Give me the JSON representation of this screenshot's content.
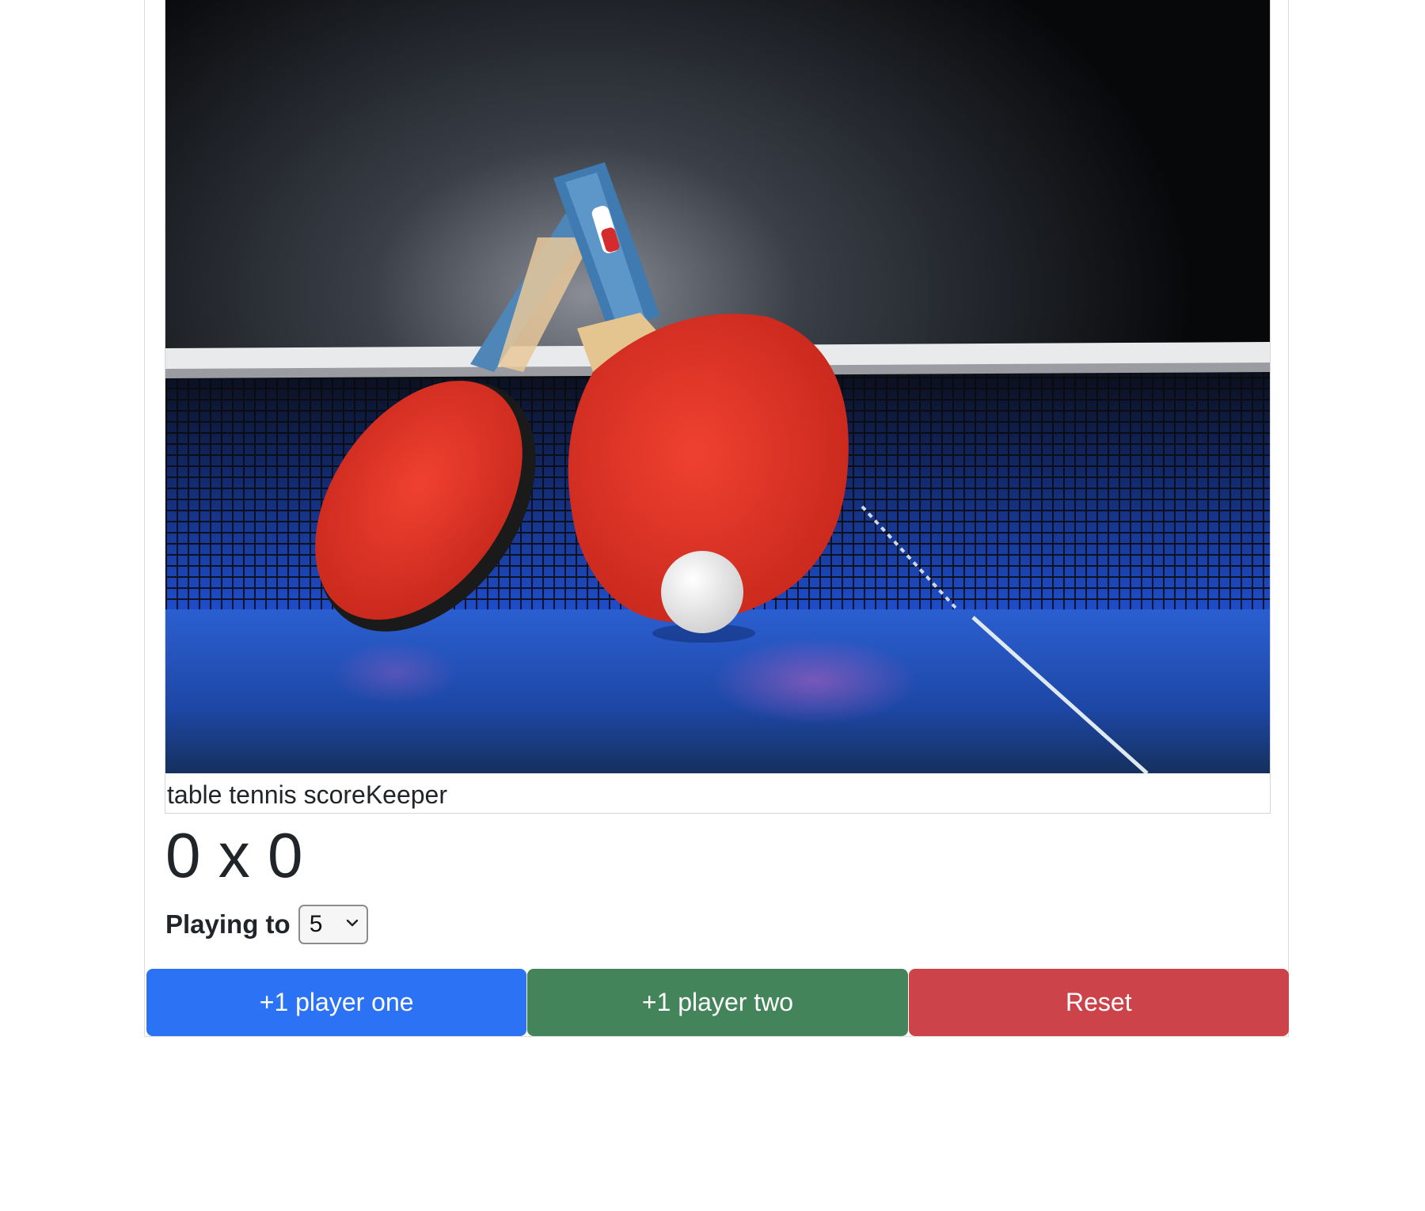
{
  "card": {
    "caption": "table tennis scoreKeeper",
    "score": {
      "player_one": "0",
      "separator": "x",
      "player_two": "0"
    },
    "playing_to": {
      "label": "Playing to",
      "selected": "5"
    },
    "buttons": {
      "player_one": "+1 player one",
      "player_two": "+1 player two",
      "reset": "Reset"
    }
  },
  "colors": {
    "primary": "#2b72f5",
    "success": "#44845a",
    "danger": "#cc434a"
  },
  "icons": {
    "select_arrow": "chevron-down-icon"
  }
}
